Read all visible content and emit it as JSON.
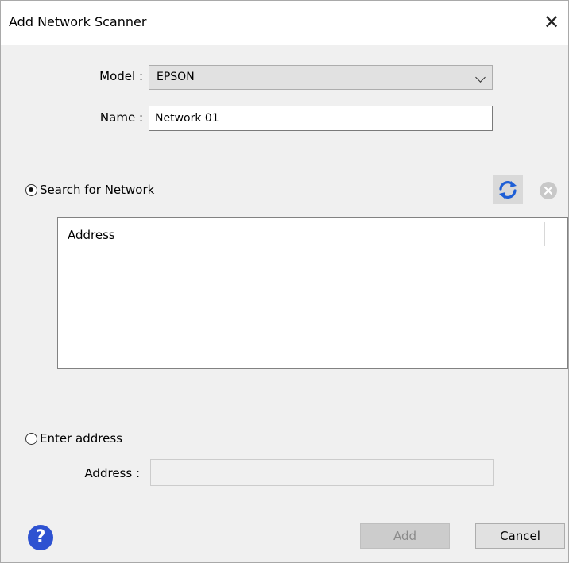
{
  "dialog": {
    "title": "Add Network Scanner",
    "close_icon": "close-x-icon"
  },
  "form": {
    "model_label": "Model :",
    "model_value": "EPSON",
    "name_label": "Name :",
    "name_value": "Network 01"
  },
  "search": {
    "option_label": "Search for Network",
    "selected": true,
    "refresh_icon": "refresh-icon",
    "refresh_color": "#1e5fd6",
    "stop_icon": "cancel-circle-icon"
  },
  "list": {
    "column_header": "Address",
    "rows": []
  },
  "manual": {
    "option_label": "Enter address",
    "selected": false,
    "address_label": "Address :",
    "address_value": ""
  },
  "footer": {
    "help_icon": "help-icon",
    "help_glyph": "?",
    "help_color": "#2e52d1",
    "add_label": "Add",
    "add_enabled": false,
    "cancel_label": "Cancel"
  }
}
